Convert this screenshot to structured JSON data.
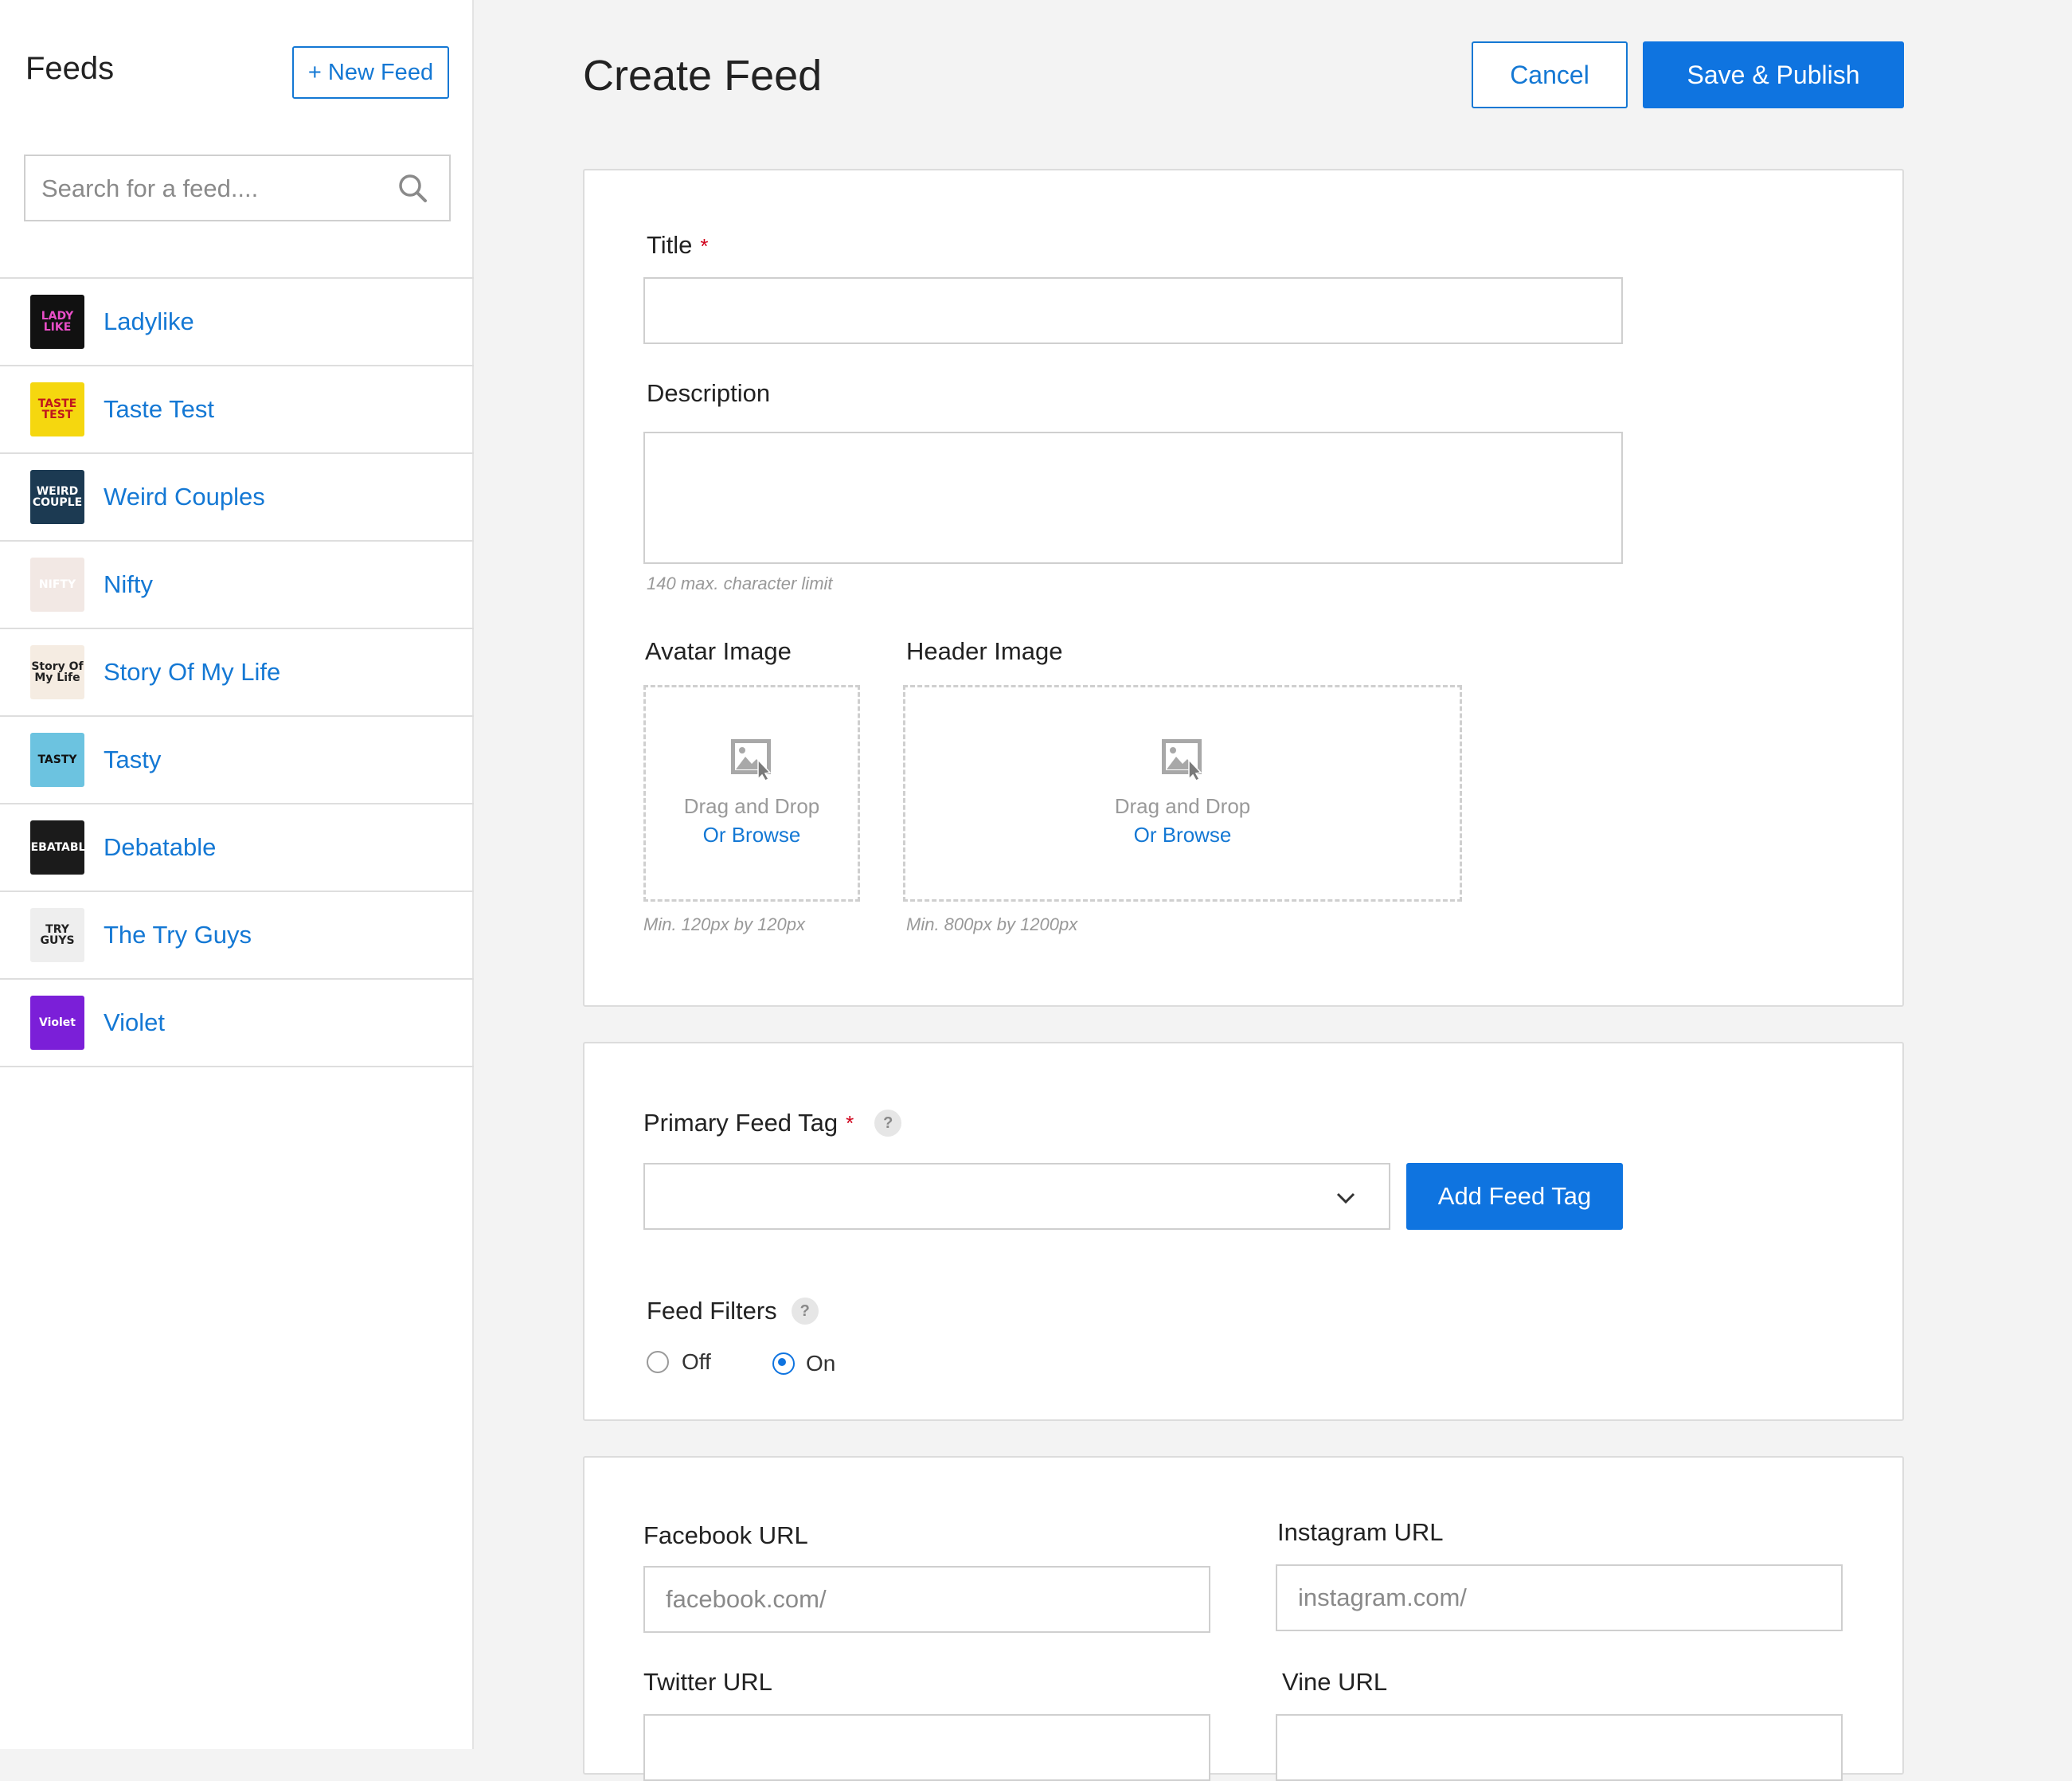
{
  "sidebar": {
    "title": "Feeds",
    "new_feed_label": "+ New Feed",
    "search_placeholder": "Search for a feed....",
    "feeds": [
      {
        "name": "Ladylike",
        "thumb_text": "LADY LIKE",
        "thumb_bg": "#111111",
        "thumb_fg": "#e94ec8"
      },
      {
        "name": "Taste Test",
        "thumb_text": "TASTE TEST",
        "thumb_bg": "#f5d70f",
        "thumb_fg": "#c0161d"
      },
      {
        "name": "Weird Couples",
        "thumb_text": "WEIRD COUPLE",
        "thumb_bg": "#1c3a52",
        "thumb_fg": "#ffffff"
      },
      {
        "name": "Nifty",
        "thumb_text": "NIFTY",
        "thumb_bg": "#f2e8e4",
        "thumb_fg": "#ffffff"
      },
      {
        "name": "Story Of My Life",
        "thumb_text": "Story Of My Life",
        "thumb_bg": "#f5ece2",
        "thumb_fg": "#222222"
      },
      {
        "name": "Tasty",
        "thumb_text": "TASTY",
        "thumb_bg": "#6cc3e0",
        "thumb_fg": "#111111"
      },
      {
        "name": "Debatable",
        "thumb_text": "DEBATABLE",
        "thumb_bg": "#1b1b1b",
        "thumb_fg": "#ffffff"
      },
      {
        "name": "The Try Guys",
        "thumb_text": "TRY GUYS",
        "thumb_bg": "#eeeeee",
        "thumb_fg": "#222222"
      },
      {
        "name": "Violet",
        "thumb_text": "Violet",
        "thumb_bg": "#7b1fd8",
        "thumb_fg": "#ffffff"
      }
    ]
  },
  "header": {
    "title": "Create Feed",
    "cancel_label": "Cancel",
    "save_label": "Save & Publish"
  },
  "basics": {
    "title_label": "Title",
    "required_mark": "*",
    "title_value": "",
    "description_label": "Description",
    "description_value": "",
    "description_hint": "140 max. character limit",
    "avatar_label": "Avatar Image",
    "avatar_drop_text": "Drag and Drop",
    "avatar_browse_text": "Or Browse",
    "avatar_hint": "Min. 120px by 120px",
    "header_label": "Header Image",
    "header_drop_text": "Drag and Drop",
    "header_browse_text": "Or Browse",
    "header_hint": "Min. 800px by 1200px"
  },
  "tags": {
    "primary_label": "Primary Feed Tag",
    "required_mark": "*",
    "help_mark": "?",
    "selected_value": "",
    "add_label": "Add Feed Tag",
    "filters_label": "Feed Filters",
    "filters_help_mark": "?",
    "filter_off_label": "Off",
    "filter_on_label": "On",
    "filter_selected": "On"
  },
  "social": {
    "facebook_label": "Facebook URL",
    "facebook_placeholder": "facebook.com/",
    "instagram_label": "Instagram URL",
    "instagram_placeholder": "instagram.com/",
    "twitter_label": "Twitter URL",
    "vine_label": "Vine URL"
  },
  "colors": {
    "accent": "#1478d4",
    "primary_button": "#0f74e0",
    "required": "#d0021b"
  }
}
